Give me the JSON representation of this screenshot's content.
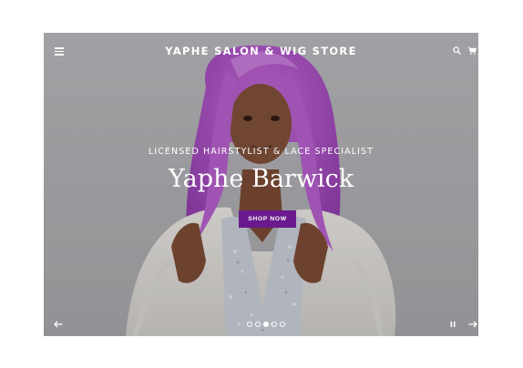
{
  "header": {
    "store_title": "YAPHE SALON & WIG STORE",
    "menu_icon": "hamburger-menu-icon",
    "search_icon": "search-icon",
    "cart_icon": "cart-icon"
  },
  "hero": {
    "eyebrow": "LICENSED HAIRSTYLIST & LACE SPECIALIST",
    "title": "Yaphe Barwick",
    "cta_label": "SHOP NOW",
    "cta_color": "#6a1a8c"
  },
  "slideshow": {
    "slide_count": 5,
    "active_slide": 3,
    "prev_icon": "arrow-left-icon",
    "next_icon": "arrow-right-icon",
    "pause_icon": "pause-icon"
  },
  "colors": {
    "background": "#b5b5b9",
    "hair": "#b05ac8",
    "text": "#ffffff"
  }
}
